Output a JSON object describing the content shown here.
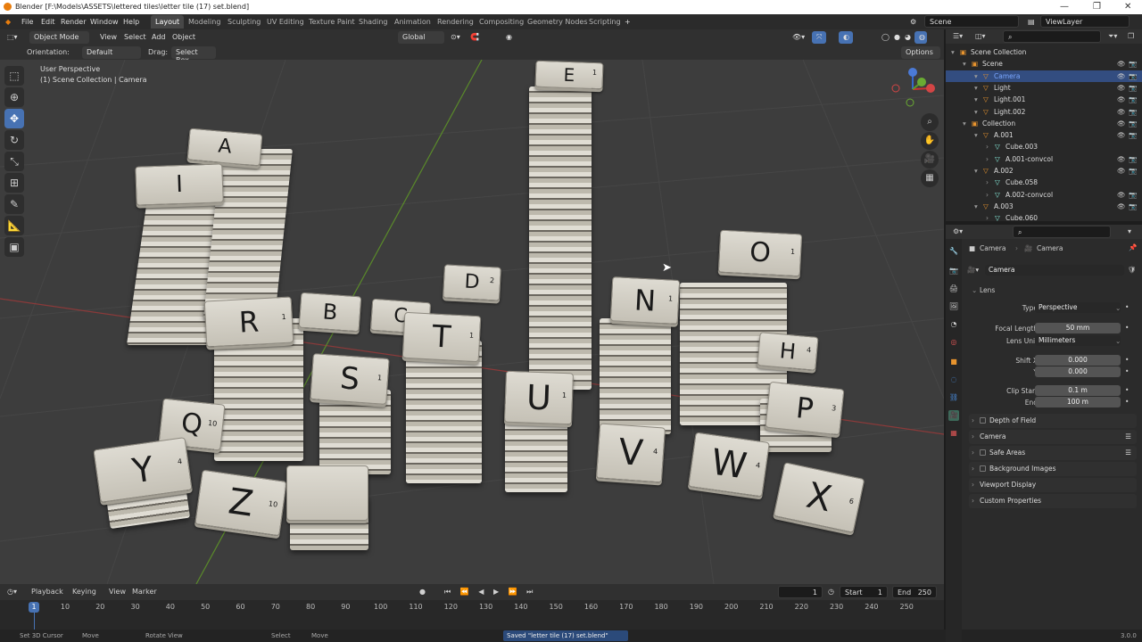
{
  "window": {
    "title": "Blender [F:\\Models\\ASSETS\\lettered tiles\\letter tile (17) set.blend]"
  },
  "menu": [
    "File",
    "Edit",
    "Render",
    "Window",
    "Help"
  ],
  "workspaces": [
    "Layout",
    "Modeling",
    "Sculpting",
    "UV Editing",
    "Texture Paint",
    "Shading",
    "Animation",
    "Rendering",
    "Compositing",
    "Geometry Nodes",
    "Scripting"
  ],
  "scene": "Scene",
  "view_layer": "ViewLayer",
  "header": {
    "mode": "Object Mode",
    "view": "View",
    "select": "Select",
    "add": "Add",
    "object": "Object",
    "transform": "Global"
  },
  "tool_header": {
    "orientation_label": "Orientation:",
    "orientation": "Default",
    "drag_label": "Drag:",
    "drag": "Select Box",
    "options": "Options"
  },
  "viewport": {
    "perspective": "User Perspective",
    "context": "(1) Scene Collection | Camera"
  },
  "tiles": {
    "a": "A",
    "i": "I",
    "r": "R",
    "b": "B",
    "c": "C",
    "d": "D",
    "t": "T",
    "s": "S",
    "e": "E",
    "u": "U",
    "n": "N",
    "o": "O",
    "h": "H",
    "p": "P",
    "q": "Q",
    "y": "Y",
    "z": "Z",
    "v": "V",
    "w": "W",
    "x": "X",
    "p1": "1",
    "p4": "4",
    "p10": "10",
    "p2": "2",
    "p3": "3",
    "p6": "6"
  },
  "timeline": {
    "playback": "Playback",
    "keying": "Keying",
    "view": "View",
    "marker": "Marker",
    "current": "1",
    "start_label": "Start",
    "start": "1",
    "end_label": "End",
    "end": "250",
    "ticks": [
      "10",
      "20",
      "30",
      "40",
      "50",
      "60",
      "70",
      "80",
      "90",
      "100",
      "110",
      "120",
      "130",
      "140",
      "150",
      "160",
      "170",
      "180",
      "190",
      "200",
      "210",
      "220",
      "230",
      "240",
      "250"
    ]
  },
  "status": {
    "set_cursor": "Set 3D Cursor",
    "move": "Move",
    "rotate": "Rotate View",
    "select": "Select",
    "move2": "Move",
    "saved": "Saved \"letter tile (17) set.blend\"",
    "version": "3.0.0"
  },
  "outliner": {
    "rows": [
      {
        "name": "Scene Collection",
        "indent": 0
      },
      {
        "name": "Scene",
        "indent": 1
      },
      {
        "name": "Camera",
        "indent": 2
      },
      {
        "name": "Light",
        "indent": 2
      },
      {
        "name": "Light.001",
        "indent": 2
      },
      {
        "name": "Light.002",
        "indent": 2
      },
      {
        "name": "Collection",
        "indent": 1
      },
      {
        "name": "A.001",
        "indent": 2
      },
      {
        "name": "Cube.003",
        "indent": 3
      },
      {
        "name": "A.001-convcol",
        "indent": 3
      },
      {
        "name": "A.002",
        "indent": 2
      },
      {
        "name": "Cube.058",
        "indent": 3
      },
      {
        "name": "A.002-convcol",
        "indent": 3
      },
      {
        "name": "A.003",
        "indent": 2
      },
      {
        "name": "Cube.060",
        "indent": 3
      }
    ]
  },
  "properties": {
    "breadcrumb": [
      "Camera",
      "Camera"
    ],
    "object_name": "Camera",
    "lens_panel": "Lens",
    "type_label": "Type",
    "type": "Perspective",
    "focal_label": "Focal Length",
    "focal": "50 mm",
    "unit_label": "Lens Unit",
    "unit": "Millimeters",
    "shiftx_label": "Shift X",
    "shiftx": "0.000",
    "shifty_label": "Y",
    "shifty": "0.000",
    "clipstart_label": "Clip Start",
    "clipstart": "0.1 m",
    "end_label": "End",
    "end": "100 m",
    "panels": [
      "Depth of Field",
      "Camera",
      "Safe Areas",
      "Background Images",
      "Viewport Display",
      "Custom Properties"
    ]
  }
}
